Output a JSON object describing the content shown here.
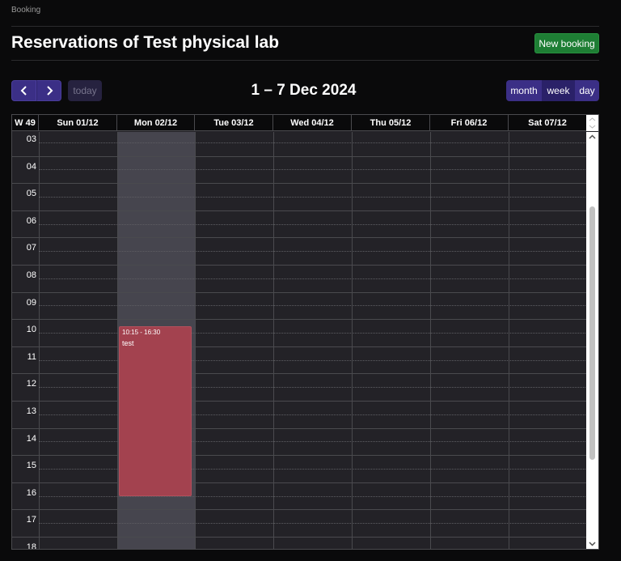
{
  "breadcrumb": "Booking",
  "page_title": "Reservations of Test physical lab",
  "new_booking_label": "New booking",
  "toolbar": {
    "prev_icon": "chevron-left-icon",
    "next_icon": "chevron-right-icon",
    "today_label": "today",
    "title": "1 – 7 Dec 2024",
    "views": [
      "month",
      "week",
      "day"
    ],
    "active_view": "week"
  },
  "calendar": {
    "week_label": "W 49",
    "days": [
      "Sun 01/12",
      "Mon 02/12",
      "Tue 03/12",
      "Wed 04/12",
      "Thu 05/12",
      "Fri 06/12",
      "Sat 07/12"
    ],
    "today_index": 1,
    "hours": [
      "03",
      "04",
      "05",
      "06",
      "07",
      "08",
      "09",
      "10",
      "11",
      "12",
      "13",
      "14",
      "15",
      "16",
      "17",
      "18"
    ],
    "events": [
      {
        "day_index": 1,
        "start_hour": 10.25,
        "end_hour": 16.5,
        "time": "10:15 - 16:30",
        "title": "test"
      }
    ]
  },
  "colors": {
    "accent": "#3b2f86",
    "success": "#1e7e34",
    "event": "#a3424f",
    "today_column": "#46454e"
  }
}
